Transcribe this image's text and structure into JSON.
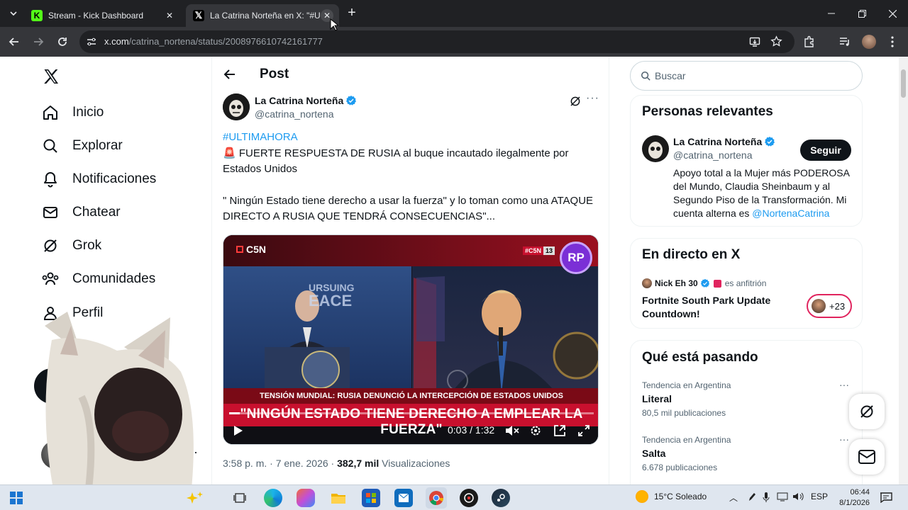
{
  "browser": {
    "tabs": [
      {
        "title": "Stream - Kick Dashboard",
        "active": false
      },
      {
        "title": "La Catrina Norteña en X: \"#ULTIMAHORA",
        "active": true
      }
    ],
    "url_host": "x.com",
    "url_path": "/catrina_nortena/status/2008976610742161777"
  },
  "nav": {
    "items": [
      {
        "label": "Inicio",
        "icon": "home-icon"
      },
      {
        "label": "Explorar",
        "icon": "search-icon"
      },
      {
        "label": "Notificaciones",
        "icon": "bell-icon"
      },
      {
        "label": "Chatear",
        "icon": "mail-icon"
      },
      {
        "label": "Grok",
        "icon": "grok-icon"
      },
      {
        "label": "Comunidades",
        "icon": "people-icon"
      },
      {
        "label": "Perfil",
        "icon": "person-icon"
      }
    ]
  },
  "post": {
    "header_title": "Post",
    "author_name": "La Catrina Norteña",
    "author_handle": "@catrina_nortena",
    "hashtag": "#ULTIMAHORA",
    "line1": "🚨 FUERTE RESPUESTA DE RUSIA al buque incautado ilegalmente por Estados Unidos",
    "line2": "\" Ningún Estado tiene derecho a usar la fuerza\" y lo toman como una ATAQUE DIRECTO A RUSIA QUE TENDRÁ CONSECUENCIAS\"...",
    "video": {
      "channel": "C5N",
      "badge_channel": "#C5N",
      "badge_num": "13",
      "rp": "RP",
      "podium_text": "URSUING",
      "podium_text2": "EACE",
      "lower_third_small": "TENSIÓN MUNDIAL: RUSIA DENUNCIÓ LA INTERCEPCIÓN DE ESTADOS UNIDOS",
      "lower_third_big": "\"NINGÚN ESTADO TIENE DERECHO A EMPLEAR LA FUERZA\"",
      "time": "0:03 / 1:32",
      "progress": 0.03
    },
    "timestamp": "3:58 p. m. · 7 ene. 2026 · ",
    "views_count": "382,7 mil",
    "views_label": " Visualizaciones"
  },
  "right": {
    "search_placeholder": "Buscar",
    "relevant": {
      "title": "Personas relevantes",
      "name": "La Catrina Norteña",
      "handle": "@catrina_nortena",
      "follow_label": "Seguir",
      "bio_text": "Apoyo total a la Mujer más PODEROSA del Mundo, Claudia Sheinbaum y al Segundo Piso de la Transformación. Mi cuenta alterna es ",
      "bio_link": "@NortenaCatrina"
    },
    "live": {
      "title": "En directo en X",
      "host_name": "Nick Eh 30",
      "host_suffix": "es anfitrión",
      "space_title": "Fortnite South Park Update Countdown!",
      "listeners": "+23"
    },
    "trending": {
      "title": "Qué está pasando",
      "items": [
        {
          "context": "Tendencia en Argentina",
          "name": "Literal",
          "count": "80,5 mil publicaciones"
        },
        {
          "context": "Tendencia en Argentina",
          "name": "Salta",
          "count": "6.678 publicaciones"
        }
      ]
    }
  },
  "taskbar": {
    "weather": "15°C  Soleado",
    "lang": "ESP",
    "time": "06:44",
    "date": "8/1/2026"
  },
  "colors": {
    "x_blue": "#1d9bf0",
    "verified": "#1d9bf0",
    "c5n_red": "#c8102e",
    "rp_purple": "#7b2fd6"
  }
}
